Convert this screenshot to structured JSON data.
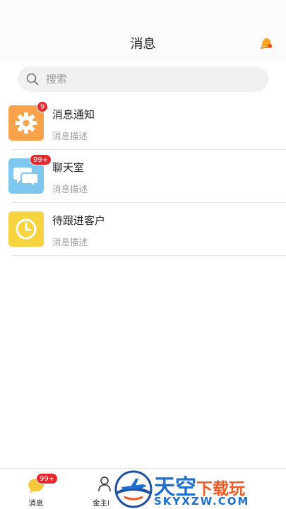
{
  "header": {
    "title": "消息"
  },
  "search": {
    "placeholder": "搜索"
  },
  "messages": [
    {
      "title": "消息通知",
      "desc": "消息描述",
      "badge": "9",
      "icon": "gear-icon",
      "color": "#f8a34a"
    },
    {
      "title": "聊天室",
      "desc": "消息描述",
      "badge": "99+",
      "icon": "chat-bubbles-icon",
      "color": "#7ec8ef"
    },
    {
      "title": "待跟进客户",
      "desc": "消息描述",
      "badge": "",
      "icon": "clock-icon",
      "color": "#f7d33f"
    }
  ],
  "tabbar": {
    "tabs": [
      {
        "label": "消息",
        "badge": "99+",
        "icon": "chat-bubble-icon",
        "active": true
      },
      {
        "label": "金主i",
        "icon": "person-icon",
        "active": false
      }
    ]
  },
  "watermark": {
    "main": "天空",
    "main_small": "下载玩",
    "sub": "SKYXZW.COM"
  },
  "colors": {
    "badge": "#e8262b",
    "brand": "#1c6ed1",
    "accent": "#f05a24"
  }
}
